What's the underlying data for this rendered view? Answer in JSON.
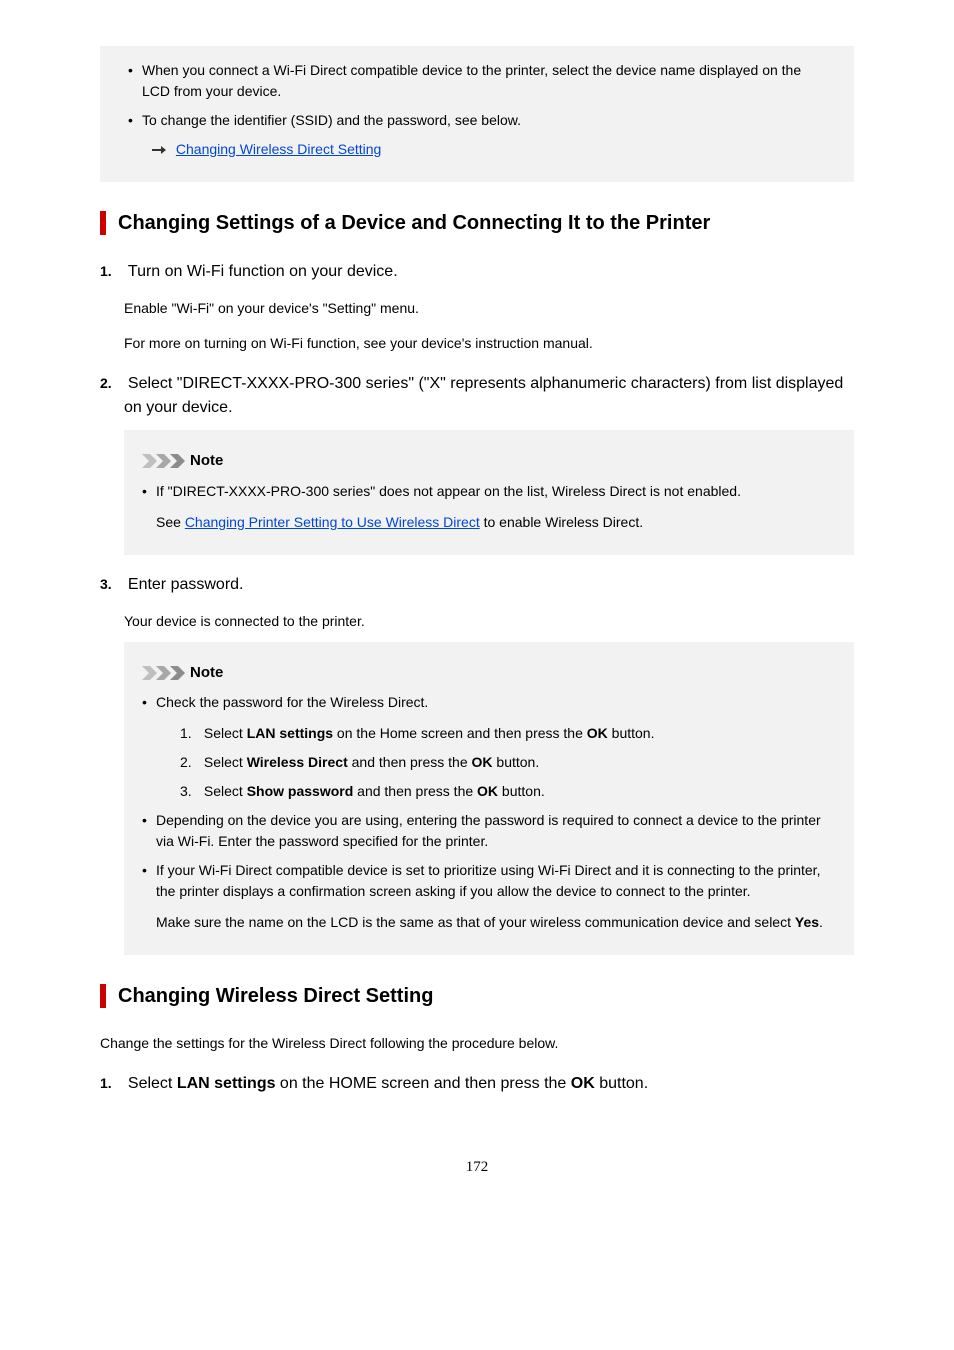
{
  "topNote": {
    "b1": "When you connect a Wi-Fi Direct compatible device to the printer, select the device name displayed on the LCD from your device.",
    "b2": "To change the identifier (SSID) and the password, see below.",
    "link": "Changing Wireless Direct Setting"
  },
  "section1": {
    "heading": "Changing Settings of a Device and Connecting It to the Printer",
    "step1": {
      "num": "1.",
      "text": "Turn on Wi-Fi function on your device.",
      "p1": "Enable \"Wi-Fi\" on your device's \"Setting\" menu.",
      "p2": "For more on turning on Wi-Fi function, see your device's instruction manual."
    },
    "step2": {
      "num": "2.",
      "text": "Select \"DIRECT-XXXX-PRO-300 series\" (\"X\" represents alphanumeric characters) from list displayed on your device.",
      "noteLabel": "Note",
      "noteBullet": "If \"DIRECT-XXXX-PRO-300 series\" does not appear on the list, Wireless Direct is not enabled.",
      "noteSeePre": "See ",
      "noteLink": "Changing Printer Setting to Use Wireless Direct",
      "noteSeePost": " to enable Wireless Direct."
    },
    "step3": {
      "num": "3.",
      "text": "Enter password.",
      "p1": "Your device is connected to the printer.",
      "noteLabel": "Note",
      "nb1": "Check the password for the Wireless Direct.",
      "o1n": "1.",
      "o1a": "Select ",
      "o1b": "LAN settings",
      "o1c": " on the Home screen and then press the ",
      "o1d": "OK",
      "o1e": " button.",
      "o2n": "2.",
      "o2a": "Select ",
      "o2b": "Wireless Direct",
      "o2c": " and then press the ",
      "o2d": "OK",
      "o2e": " button.",
      "o3n": "3.",
      "o3a": "Select ",
      "o3b": "Show password",
      "o3c": " and then press the ",
      "o3d": "OK",
      "o3e": " button.",
      "nb2": "Depending on the device you are using, entering the password is required to connect a device to the printer via Wi-Fi. Enter the password specified for the printer.",
      "nb3": "If your Wi-Fi Direct compatible device is set to prioritize using Wi-Fi Direct and it is connecting to the printer, the printer displays a confirmation screen asking if you allow the device to connect to the printer.",
      "nb3pA": "Make sure the name on the LCD is the same as that of your wireless communication device and select ",
      "nb3pB": "Yes",
      "nb3pC": "."
    }
  },
  "section2": {
    "heading": "Changing Wireless Direct Setting",
    "intro": "Change the settings for the Wireless Direct following the procedure below.",
    "step1": {
      "num": "1.",
      "a": "Select ",
      "b": "LAN settings",
      "c": " on the HOME screen and then press the ",
      "d": "OK",
      "e": " button."
    }
  },
  "pageNumber": "172"
}
